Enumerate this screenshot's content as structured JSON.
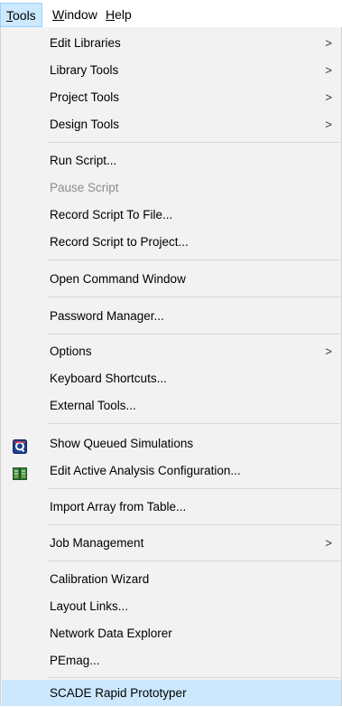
{
  "menubar": {
    "tools": {
      "accel": "T",
      "rest": "ools"
    },
    "window": {
      "accel": "W",
      "rest": "indow"
    },
    "help": {
      "accel": "H",
      "rest": "elp"
    }
  },
  "menu": {
    "submenu_arrow": ">",
    "edit_libraries": "Edit Libraries",
    "library_tools": "Library Tools",
    "project_tools": "Project Tools",
    "design_tools": "Design Tools",
    "run_script": "Run Script...",
    "pause_script": "Pause Script",
    "record_script_to_file": "Record Script To File...",
    "record_script_to_project": "Record Script to Project...",
    "open_command_window": "Open Command Window",
    "password_manager": "Password Manager...",
    "options": "Options",
    "keyboard_shortcuts": "Keyboard Shortcuts...",
    "external_tools": "External Tools...",
    "show_queued_simulations": "Show Queued Simulations",
    "edit_active_analysis": "Edit Active Analysis Configuration...",
    "import_array": "Import Array from Table...",
    "job_management": "Job Management",
    "calibration_wizard": "Calibration Wizard",
    "layout_links": "Layout Links...",
    "network_data_explorer": "Network Data Explorer",
    "pemag": "PEmag...",
    "scade_rapid_prototyper": "SCADE Rapid Prototyper"
  },
  "icons": {
    "queued_simulations": "queue-icon",
    "analysis_configuration": "analysis-config-icon"
  },
  "colors": {
    "menu_background": "#f2f2f2",
    "highlight": "#cce8ff",
    "disabled_text": "#8c8c8c"
  }
}
